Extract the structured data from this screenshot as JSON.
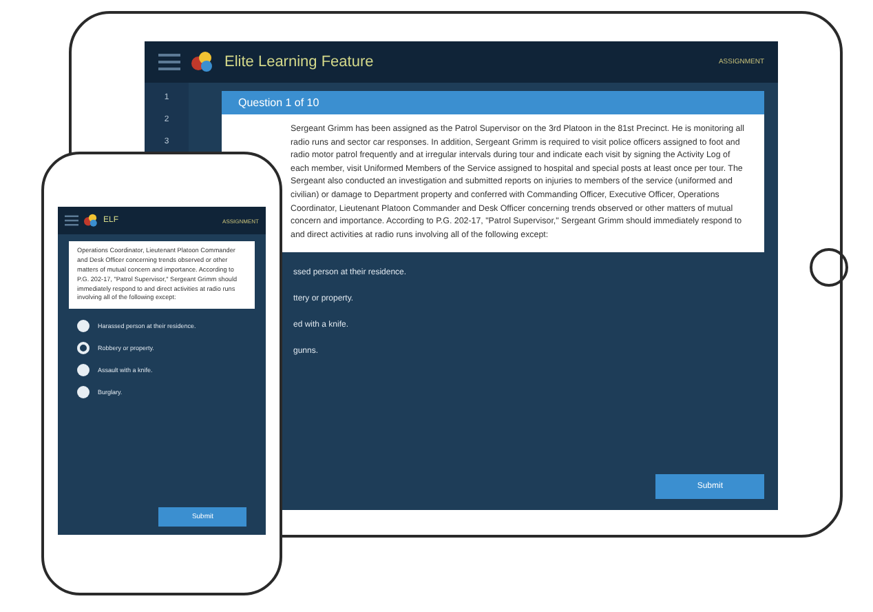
{
  "tablet": {
    "app_title": "Elite Learning Feature",
    "header_right": "ASSIGNMENT",
    "steps": [
      "1",
      "2",
      "3"
    ],
    "question_title": "Question 1 of 10",
    "question_text": "Sergeant Grimm has been assigned as the Patrol Supervisor on the 3rd Platoon in the 81st Precinct. He is monitoring all radio runs and sector car responses. In addition, Sergeant Grimm is required to visit police officers assigned to foot and radio motor patrol frequently and at irregular intervals during tour and indicate each visit by signing the Activity Log of each member, visit Uniformed Members of the Service assigned to hospital and special posts at least once per tour. The Sergeant also conducted an investigation and submitted reports on injuries to members of the service (uniformed and civilian) or damage to Department property and conferred with Commanding Officer, Executive Officer, Operations Coordinator, Lieutenant Platoon Commander and Desk Officer concerning trends observed or other matters of mutual concern and importance. According to P.G. 202-17, \"Patrol Supervisor,\" Sergeant Grimm should immediately respond to and direct activities at radio runs involving all of the following except:",
    "options": [
      "ssed person at their residence.",
      "ttery or property.",
      "ed with a knife.",
      "gunns."
    ],
    "submit": "Submit"
  },
  "phone": {
    "app_title": "ELF",
    "header_right": "ASSIGNMENT",
    "question_text": "Operations Coordinator, Lieutenant Platoon Commander and Desk Officer concerning trends observed or other matters of mutual concern and importance. According to P.G. 202-17, \"Patrol Supervisor,\" Sergeant Grimm should immediately respond to and direct activities at radio runs involving all of the following except:",
    "options": [
      {
        "label": "Harassed person at their residence.",
        "selected": false
      },
      {
        "label": "Robbery or property.",
        "selected": true
      },
      {
        "label": "Assault with a knife.",
        "selected": false
      },
      {
        "label": "Burglary.",
        "selected": false
      }
    ],
    "submit": "Submit"
  }
}
